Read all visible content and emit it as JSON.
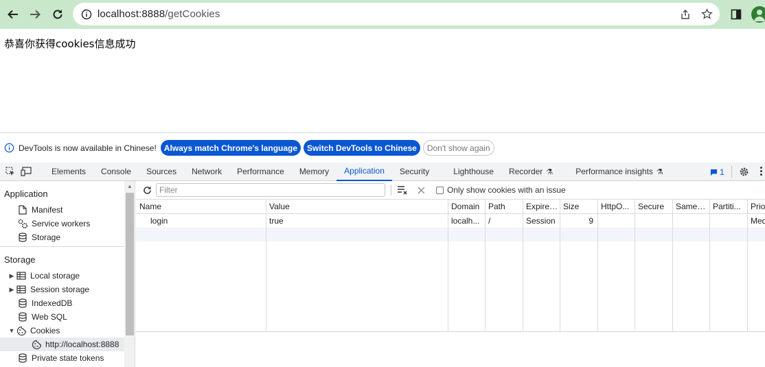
{
  "browser": {
    "url_host": "localhost:8888",
    "url_path": "/getCookies"
  },
  "page": {
    "message": "恭喜你获得cookies信息成功"
  },
  "infobar": {
    "message": "DevTools is now available in Chinese!",
    "btn_match": "Always match Chrome's language",
    "btn_switch": "Switch DevTools to Chinese",
    "btn_dont_show": "Don't show again"
  },
  "tabs": [
    "Elements",
    "Console",
    "Sources",
    "Network",
    "Performance",
    "Memory",
    "Application",
    "Security",
    "Lighthouse",
    "Recorder",
    "Performance insights"
  ],
  "active_tab": "Application",
  "issues_count": "1",
  "sidebar": {
    "application_title": "Application",
    "application_items": [
      "Manifest",
      "Service workers",
      "Storage"
    ],
    "storage_title": "Storage",
    "storage_items": [
      "Local storage",
      "Session storage",
      "IndexedDB",
      "Web SQL",
      "Cookies",
      "http://localhost:8888",
      "Private state tokens"
    ]
  },
  "cookie_panel": {
    "filter_placeholder": "Filter",
    "only_issue_label": "Only show cookies with an issue",
    "columns": [
      "Name",
      "Value",
      "Domain",
      "Path",
      "Expires...",
      "Size",
      "HttpO...",
      "Secure",
      "SameS...",
      "Partiti...",
      "Prio"
    ],
    "rows": [
      {
        "name": "login",
        "value": "true",
        "domain": "localh...",
        "path": "/",
        "expires": "Session",
        "size": "9",
        "httponly": "",
        "secure": "",
        "samesite": "",
        "partition": "",
        "priority": "Med"
      }
    ]
  },
  "colors": {
    "toolbar_bg": "#c9e8cb",
    "accent": "#0b57d0"
  }
}
